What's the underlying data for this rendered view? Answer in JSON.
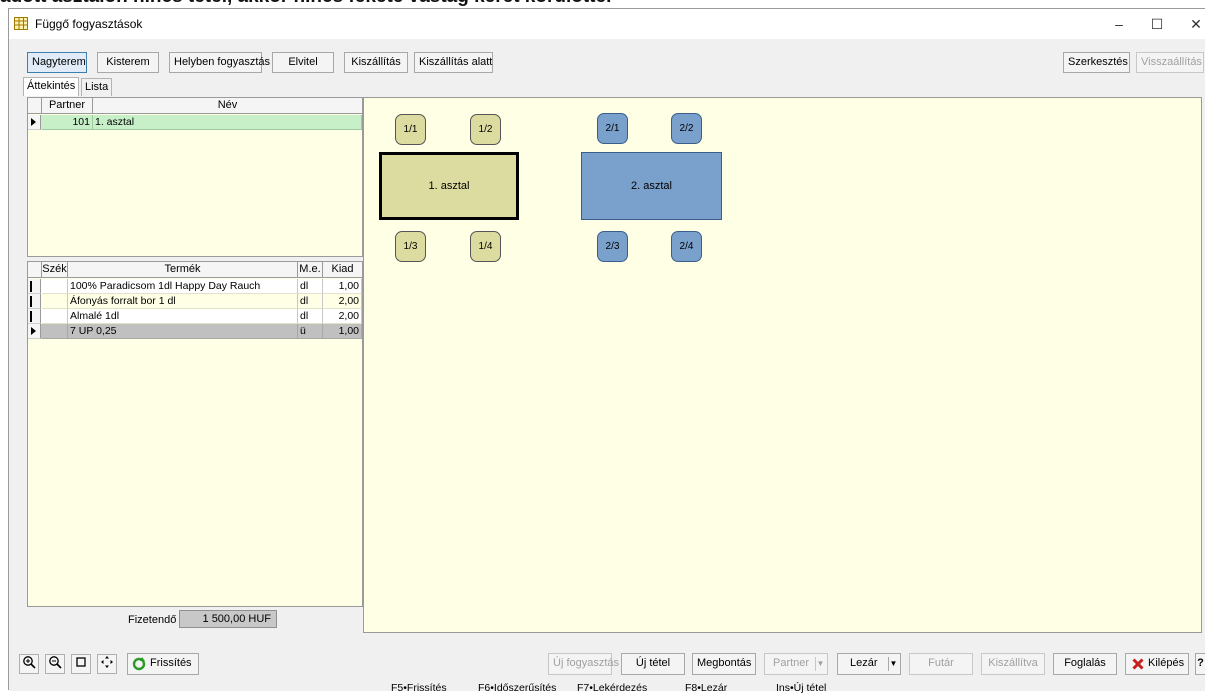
{
  "overlay_text": "adott asztalon nincs tétel, akkor nincs fekete vastag keret körülötte.",
  "window": {
    "title": "Függő fogyasztások",
    "minimize": "–",
    "maximize": "☐",
    "close": "✕"
  },
  "toolbar": {
    "rooms": [
      "Nagyterem",
      "Kisterem",
      "Helyben fogyasztás",
      "Elvitel",
      "Kiszállítás",
      "Kiszállítás alatt"
    ],
    "active_room": "Nagyterem",
    "edit_label": "Szerkesztés",
    "restore_label": "Visszaállítás"
  },
  "tabs": {
    "overview": "Áttekintés",
    "list": "Lista"
  },
  "partner_grid": {
    "headers": {
      "partner": "Partner",
      "name": "Név"
    },
    "rows": [
      {
        "partner": "101",
        "name": "1. asztal"
      }
    ]
  },
  "items_grid": {
    "headers": {
      "seat": "Szék",
      "product": "Termék",
      "unit": "M.e.",
      "qty": "Kiad"
    },
    "rows": [
      {
        "product": "100% Paradicsom 1dl Happy Day Rauch",
        "unit": "dl",
        "qty": "1,00"
      },
      {
        "product": "Áfonyás forralt bor 1 dl",
        "unit": "dl",
        "qty": "2,00"
      },
      {
        "product": "Almalé 1dl",
        "unit": "dl",
        "qty": "2,00"
      },
      {
        "product": "7 UP 0,25",
        "unit": "ü",
        "qty": "1,00"
      }
    ]
  },
  "payable": {
    "label": "Fizetendő",
    "value": "1 500,00 HUF"
  },
  "collapse_arrow": "‹",
  "floor_plan": {
    "tables": [
      {
        "name": "1. asztal",
        "color": "#dcdca0",
        "has_items": true,
        "seats": [
          "1/1",
          "1/2",
          "1/3",
          "1/4"
        ]
      },
      {
        "name": "2. asztal",
        "color": "#7aa0cc",
        "has_items": false,
        "seats": [
          "2/1",
          "2/2",
          "2/3",
          "2/4"
        ]
      }
    ]
  },
  "bottom": {
    "refresh_label": "Frissítés",
    "buttons": {
      "new_consumption": "Új fogyasztás",
      "new_item": "Új tétel",
      "split": "Megbontás",
      "partner": "Partner",
      "close_bill": "Lezár",
      "courier": "Futár",
      "delivered": "Kiszállítva",
      "booking": "Foglalás",
      "exit": "Kilépés",
      "help": "?"
    }
  },
  "status_bar": [
    "F5•Frissítés",
    "F6•Időszerűsítés",
    "F7•Lekérdezés",
    "F8•Lezár",
    "Ins•Új tétel"
  ]
}
